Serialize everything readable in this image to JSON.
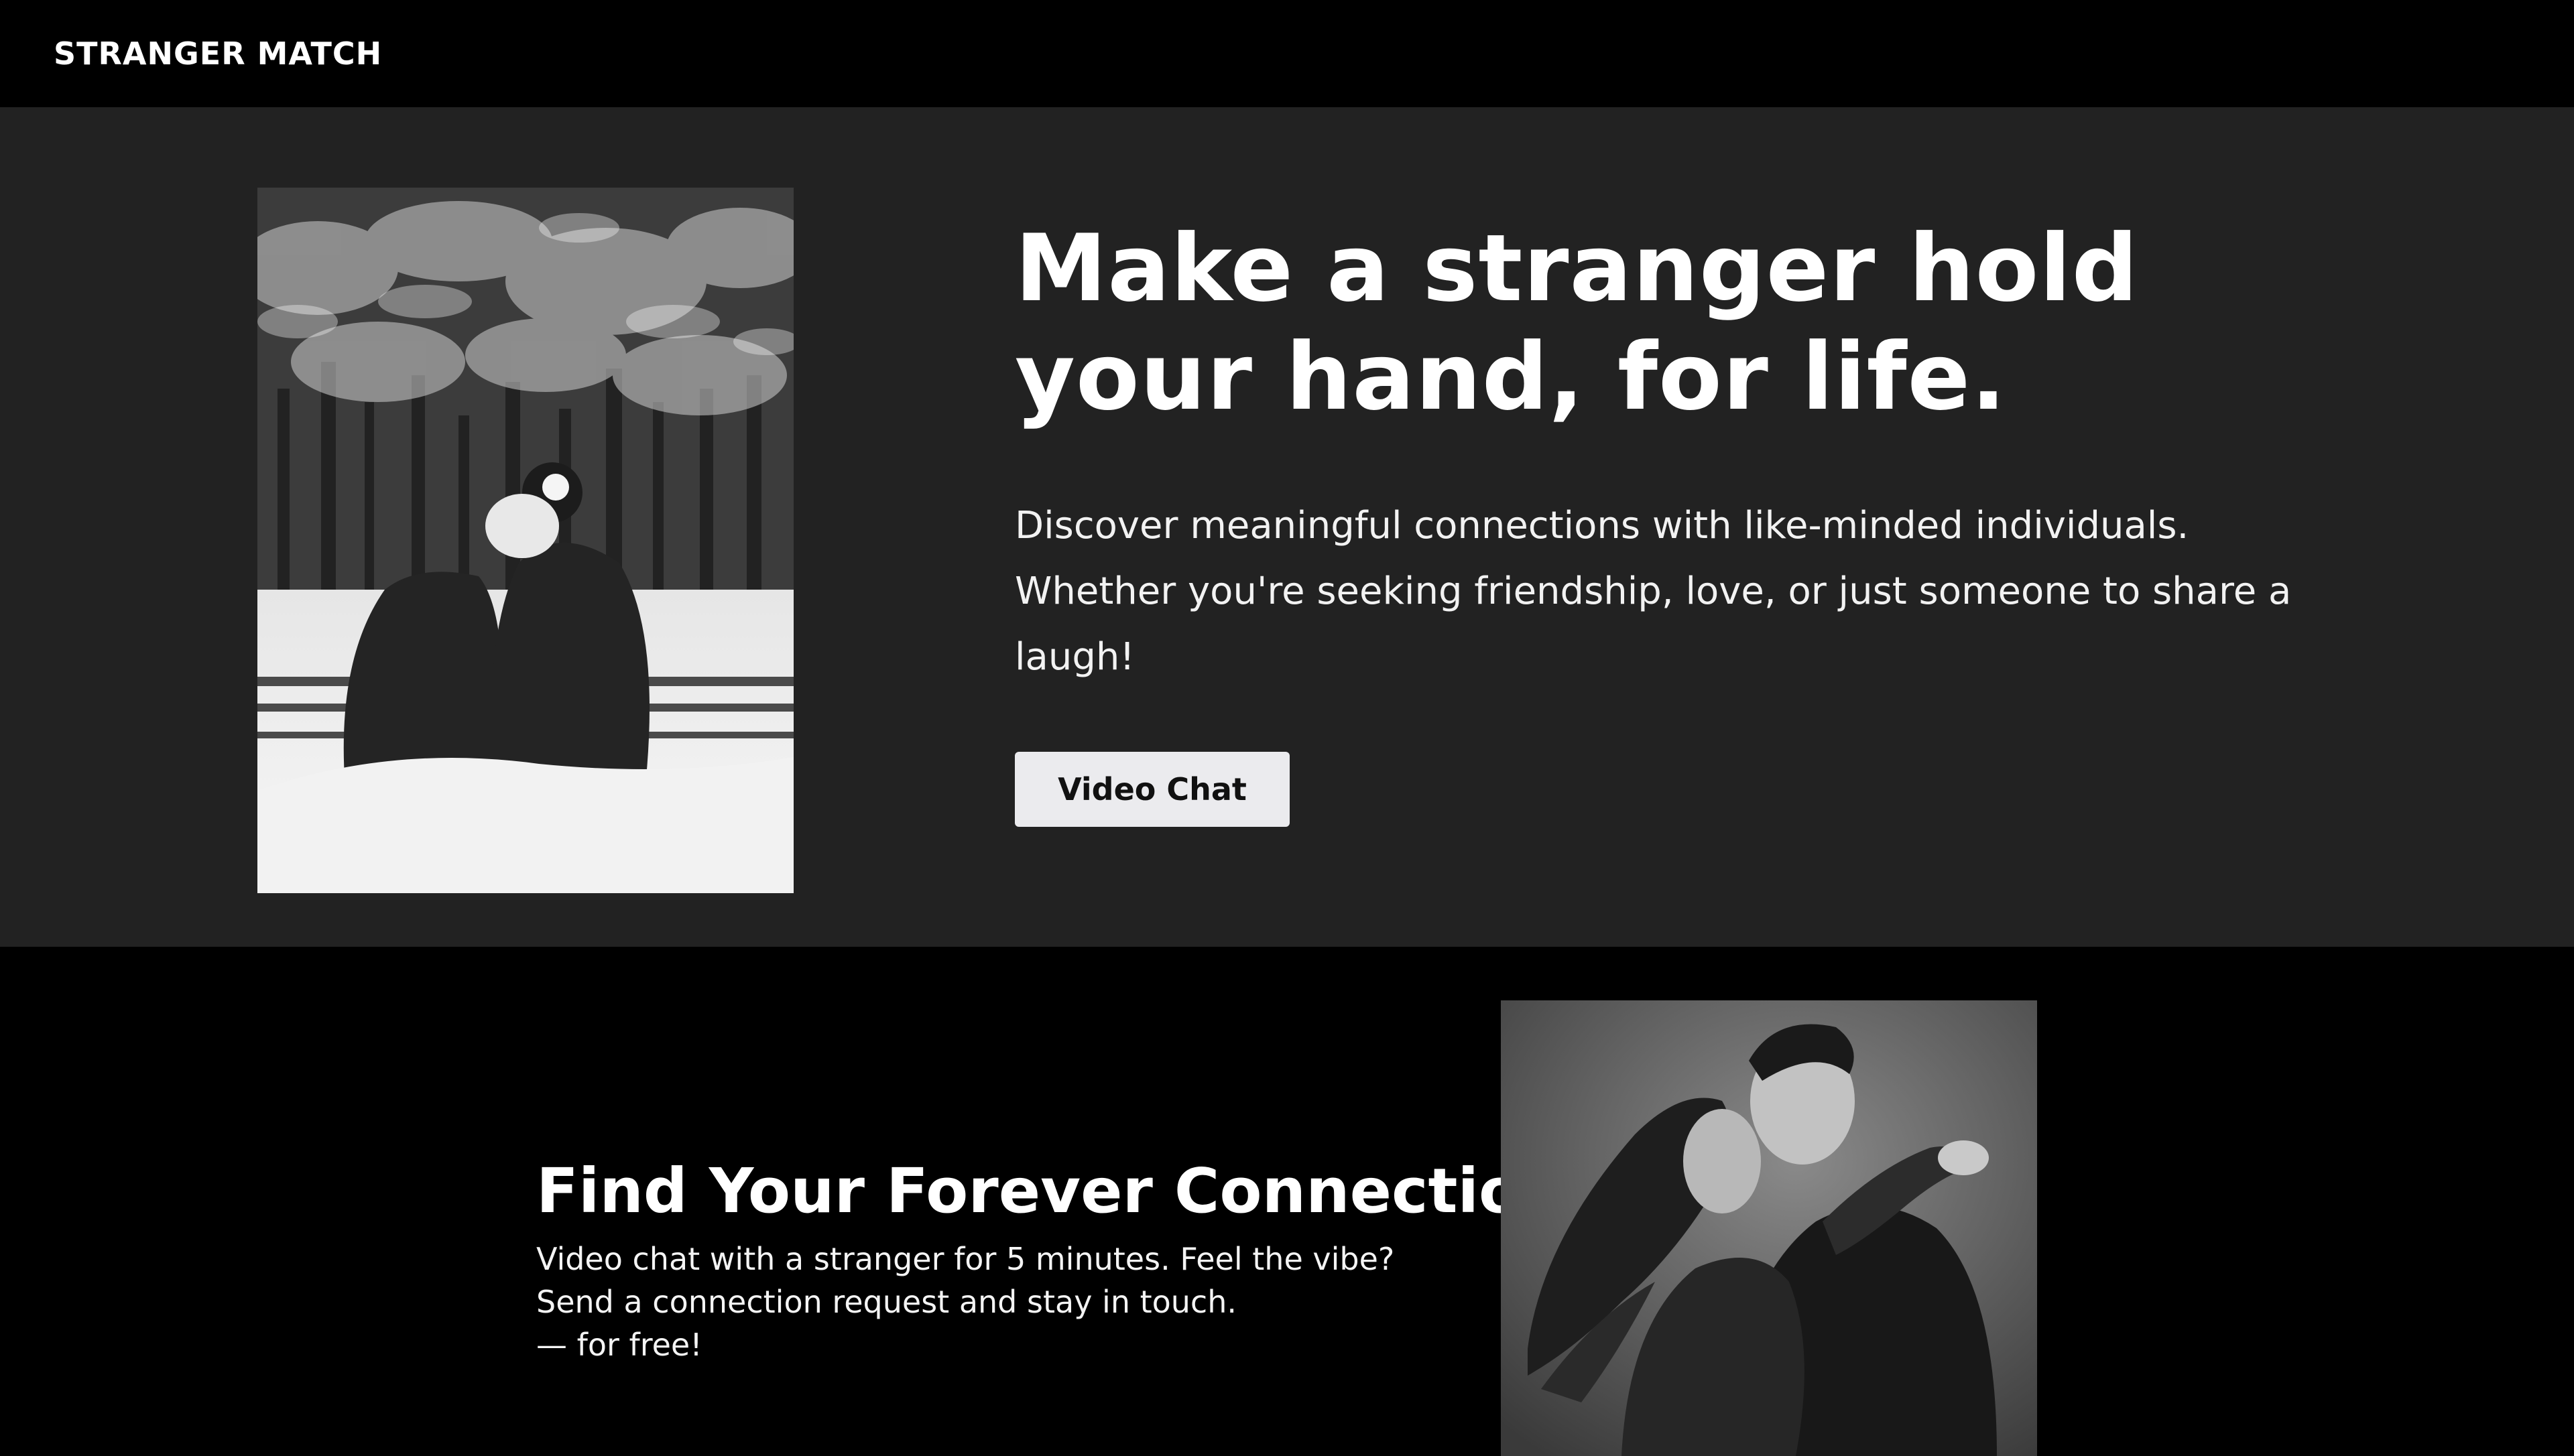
{
  "nav": {
    "brand": "STRANGER MATCH"
  },
  "hero": {
    "title_line1": "Make a stranger hold",
    "title_line2": "your hand, for life.",
    "subtitle": "Discover meaningful connections with like-minded individuals. Whether you're seeking friendship, love, or just someone to share a laugh!",
    "cta_label": "Video Chat"
  },
  "feature": {
    "title": "Find Your Forever Connection",
    "lines": [
      "Video chat with a stranger for 5 minutes. Feel the vibe?",
      "Send a connection request and stay in touch.",
      "— for free!"
    ]
  },
  "colors": {
    "page_background": "#000000",
    "hero_background": "#222222",
    "cta_background": "#ebebee",
    "cta_text": "#111111",
    "text_primary": "#ffffff"
  }
}
